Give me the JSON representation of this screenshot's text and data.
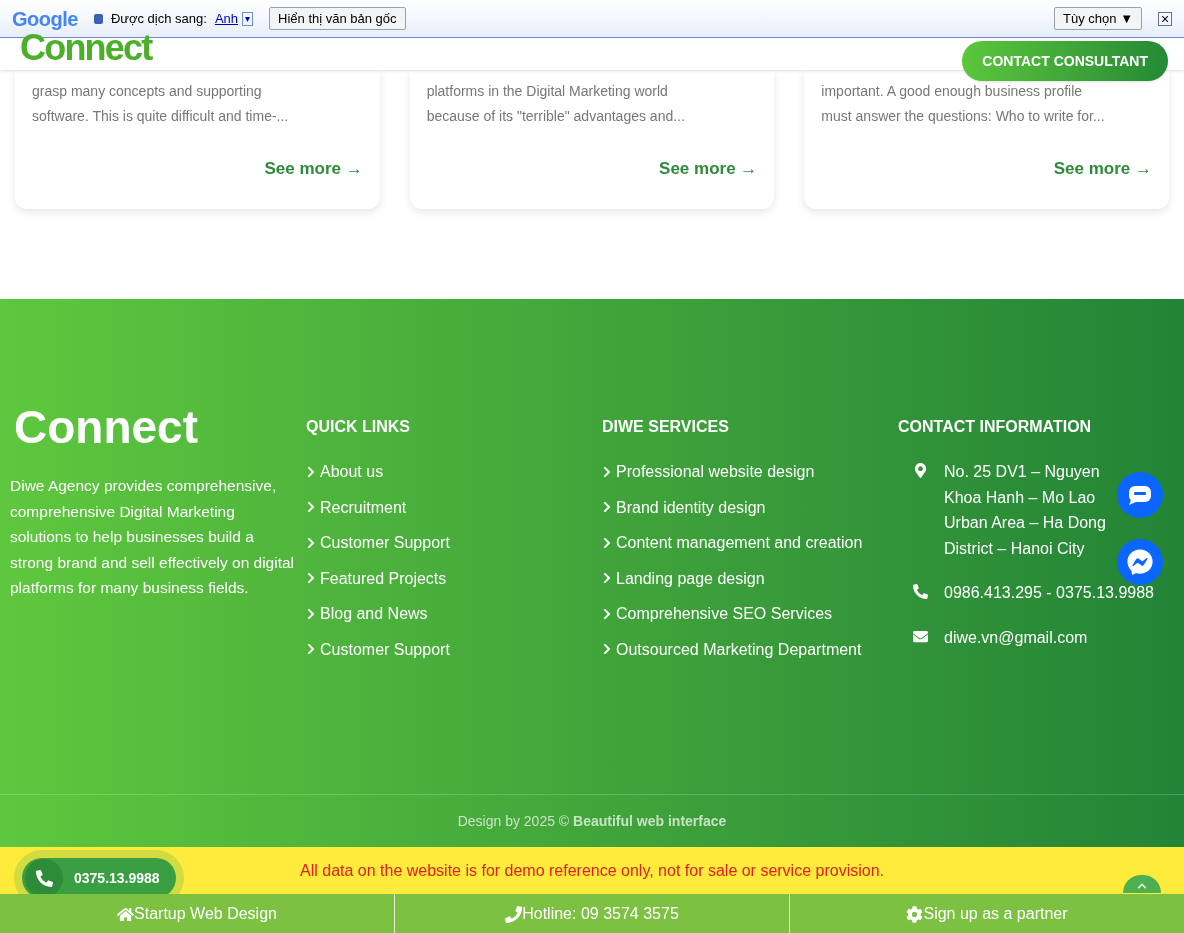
{
  "translate_bar": {
    "brand": "Google",
    "label": "Được dịch sang:",
    "language": "Anh",
    "dropdown": "▾",
    "show_original": "Hiển thị văn bản gốc",
    "options": "Tùy chọn ▼",
    "close": "×"
  },
  "header": {
    "logo": "Connect",
    "cta": "CONTACT CONSULTANT"
  },
  "cards": [
    {
      "lines": [
        "grasp many concepts and supporting",
        "software. This is quite difficult and time-..."
      ],
      "link": "See more →"
    },
    {
      "lines": [
        "platforms in the Digital Marketing world",
        "because of its \"terrible\" advantages and..."
      ],
      "link": "See more →"
    },
    {
      "lines": [
        "important. A good enough business profile",
        "must answer the questions: Who to write for..."
      ],
      "link": "See more →"
    }
  ],
  "footer": {
    "logo": "Connect",
    "about": "Diwe Agency provides comprehensive, comprehensive Digital Marketing solutions to help businesses build a strong brand and sell effectively on digital platforms for many business fields.",
    "quick_links": {
      "title": "QUICK LINKS",
      "items": [
        "About us",
        "Recruitment",
        "Customer Support",
        "Featured Projects",
        "Blog and News",
        "Customer Support"
      ]
    },
    "services": {
      "title": "DIWE SERVICES",
      "items": [
        "Professional website design",
        "Brand identity design",
        "Content management and creation",
        "Landing page design",
        "Comprehensive SEO Services",
        "Outsourced Marketing Department"
      ]
    },
    "contact": {
      "title": "CONTACT INFORMATION",
      "items": [
        {
          "kind": "address",
          "text": "No. 25 DV1 – Nguyen Khoa Hanh – Mo Lao Urban Area – Ha Dong District – Hanoi City"
        },
        {
          "kind": "phone",
          "text": "0986.413.295 - 0375.13.9988"
        },
        {
          "kind": "email",
          "text": "diwe.vn@gmail.com"
        }
      ]
    },
    "copyright": "Design by 2025 © **Beautiful web interface**"
  },
  "notice": "All data on the website is for demo reference only, not for sale or service provision.",
  "floating_phone": "0375.13.9988",
  "bottom_bar": [
    {
      "kind": "home",
      "label": "Startup Web Design"
    },
    {
      "kind": "phone",
      "label": "Hotline: 09 3574 3575"
    },
    {
      "kind": "gear",
      "label": "Sign up as a partner"
    }
  ]
}
